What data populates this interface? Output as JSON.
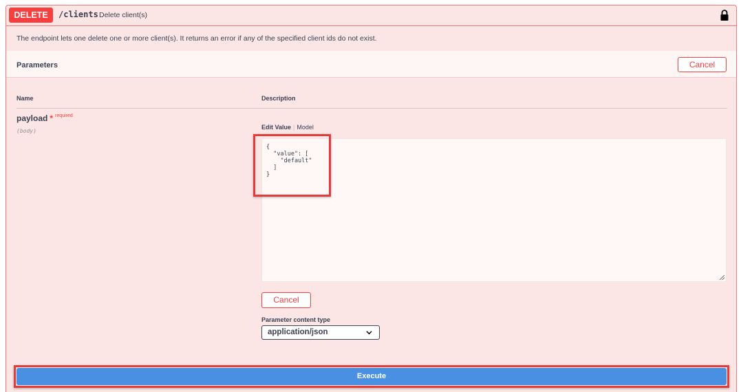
{
  "operation": {
    "method": "DELETE",
    "path": "/clients",
    "summary": "Delete client(s)",
    "description": "The endpoint lets one delete one or more client(s). It returns an error if any of the specified client ids do not exist.",
    "lock_icon": "lock-icon"
  },
  "parameters": {
    "title": "Parameters",
    "cancel_label": "Cancel",
    "columns": {
      "name": "Name",
      "description": "Description"
    },
    "param": {
      "name": "payload",
      "required_star": "*",
      "required_label": "required",
      "location": "(body)"
    },
    "tabs": {
      "edit_value": "Edit Value",
      "separator": "|",
      "model": "Model"
    },
    "body_value": "{\n  \"value\": [\n    \"default\"\n  ]\n}",
    "cancel_label_2": "Cancel",
    "content_type_label": "Parameter content type",
    "content_type_selected": "application/json"
  },
  "execute_label": "Execute",
  "colors": {
    "delete": "#f93e3e",
    "execute": "#4990e2",
    "highlight": "#e23d3d"
  }
}
